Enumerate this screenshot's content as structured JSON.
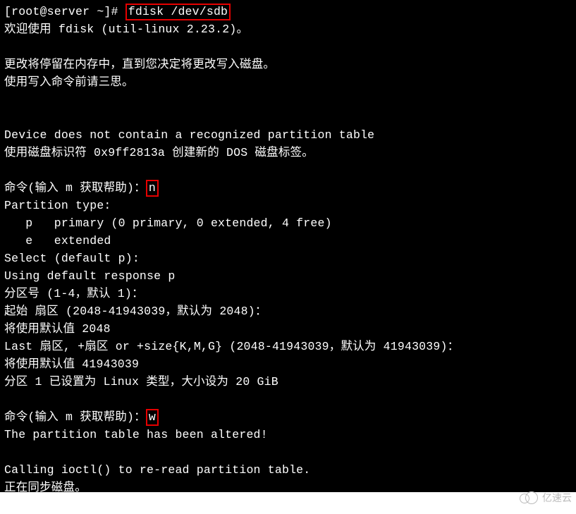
{
  "prompt": {
    "user": "root",
    "host": "server",
    "path": "~",
    "symbol": "#",
    "full": "[root@server ~]# "
  },
  "cmd1": "fdisk /dev/sdb",
  "l01": "欢迎使用 fdisk (util-linux 2.23.2)。",
  "l02": "",
  "l03": "更改将停留在内存中，直到您决定将更改写入磁盘。",
  "l04": "使用写入命令前请三思。",
  "l05": "",
  "l06": "",
  "l07": "Device does not contain a recognized partition table",
  "l08": "使用磁盘标识符 0x9ff2813a 创建新的 DOS 磁盘标签。",
  "l09": "",
  "l10": "命令(输入 m 获取帮助)：",
  "input_n": "n",
  "l11": "Partition type:",
  "l12": "   p   primary (0 primary, 0 extended, 4 free)",
  "l13": "   e   extended",
  "l14": "Select (default p):",
  "l15": "Using default response p",
  "l16": "分区号 (1-4，默认 1)：",
  "l17": "起始 扇区 (2048-41943039，默认为 2048)：",
  "l18": "将使用默认值 2048",
  "l19": "Last 扇区, +扇区 or +size{K,M,G} (2048-41943039，默认为 41943039)：",
  "l20": "将使用默认值 41943039",
  "l21": "分区 1 已设置为 Linux 类型，大小设为 20 GiB",
  "l22": "",
  "l23": "命令(输入 m 获取帮助)：",
  "input_w": "w",
  "l24": "The partition table has been altered!",
  "l25": "",
  "l26": "Calling ioctl() to re-read partition table.",
  "l27": "正在同步磁盘。",
  "watermark": "亿速云"
}
